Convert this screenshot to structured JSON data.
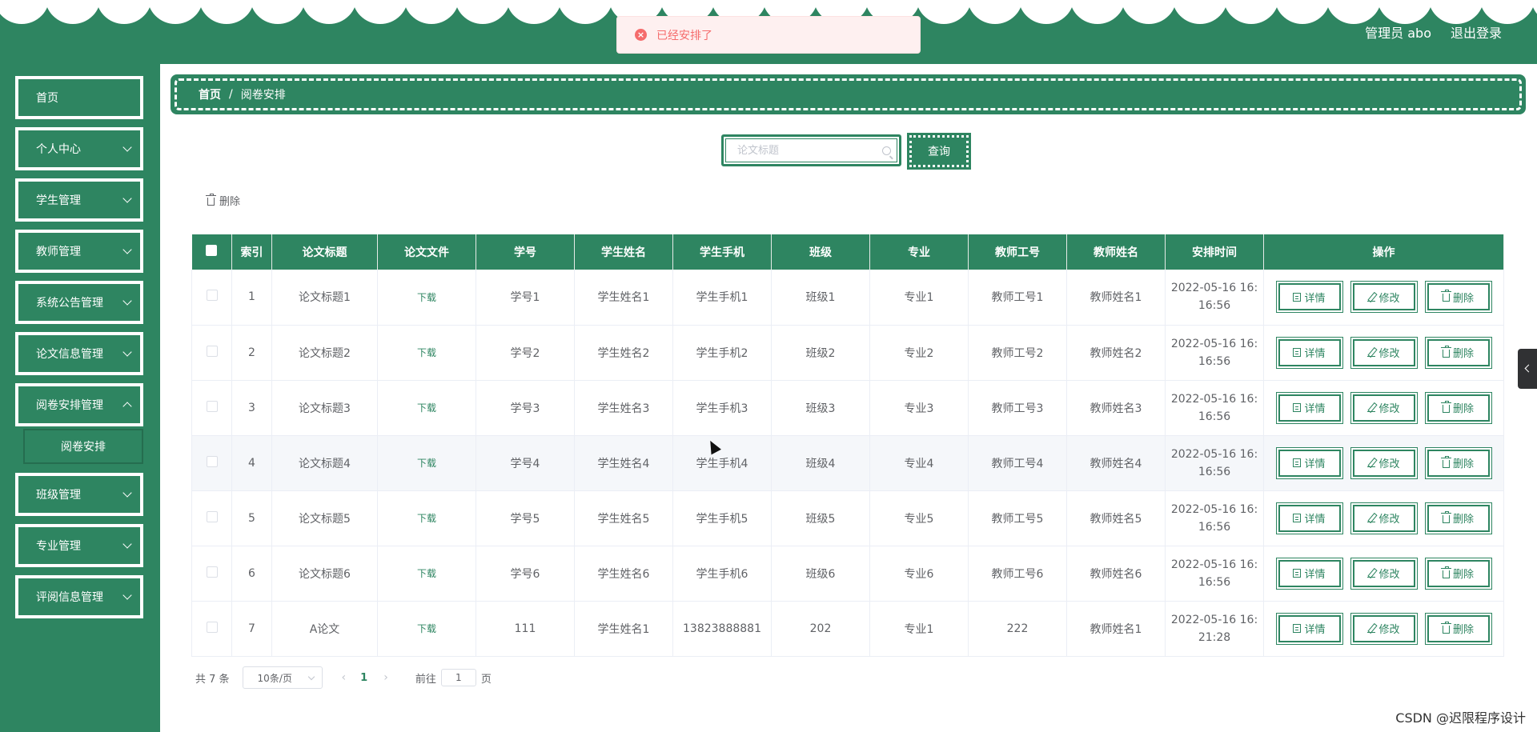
{
  "header": {
    "admin_label": "管理员 abo",
    "logout_label": "退出登录",
    "accent": "#2e8561"
  },
  "toast": {
    "message": "已经安排了",
    "type": "error"
  },
  "sidebar": {
    "items": [
      {
        "label": "首页",
        "has_children": false
      },
      {
        "label": "个人中心",
        "has_children": true
      },
      {
        "label": "学生管理",
        "has_children": true
      },
      {
        "label": "教师管理",
        "has_children": true
      },
      {
        "label": "系统公告管理",
        "has_children": true
      },
      {
        "label": "论文信息管理",
        "has_children": true
      },
      {
        "label": "阅卷安排管理",
        "has_children": true
      },
      {
        "label": "班级管理",
        "has_children": true
      },
      {
        "label": "专业管理",
        "has_children": true
      },
      {
        "label": "评阅信息管理",
        "has_children": true
      }
    ],
    "submenu": {
      "label": "阅卷安排"
    }
  },
  "breadcrumb": {
    "home": "首页",
    "separator": "/",
    "current": "阅卷安排"
  },
  "search": {
    "placeholder": "论文标题",
    "button_label": "查询"
  },
  "toolbar": {
    "batch_delete_label": "删除"
  },
  "table": {
    "columns": [
      "索引",
      "论文标题",
      "论文文件",
      "学号",
      "学生姓名",
      "学生手机",
      "班级",
      "专业",
      "教师工号",
      "教师姓名",
      "安排时间",
      "操作"
    ],
    "download_label": "下载",
    "actions": {
      "detail": "详情",
      "edit": "修改",
      "delete": "删除"
    },
    "rows": [
      {
        "index": "1",
        "title": "论文标题1",
        "student_no": "学号1",
        "student_name": "学生姓名1",
        "phone": "学生手机1",
        "class": "班级1",
        "major": "专业1",
        "teacher_no": "教师工号1",
        "teacher_name": "教师姓名1",
        "time_line1": "2022-05-16 16:",
        "time_line2": "16:56"
      },
      {
        "index": "2",
        "title": "论文标题2",
        "student_no": "学号2",
        "student_name": "学生姓名2",
        "phone": "学生手机2",
        "class": "班级2",
        "major": "专业2",
        "teacher_no": "教师工号2",
        "teacher_name": "教师姓名2",
        "time_line1": "2022-05-16 16:",
        "time_line2": "16:56"
      },
      {
        "index": "3",
        "title": "论文标题3",
        "student_no": "学号3",
        "student_name": "学生姓名3",
        "phone": "学生手机3",
        "class": "班级3",
        "major": "专业3",
        "teacher_no": "教师工号3",
        "teacher_name": "教师姓名3",
        "time_line1": "2022-05-16 16:",
        "time_line2": "16:56"
      },
      {
        "index": "4",
        "title": "论文标题4",
        "student_no": "学号4",
        "student_name": "学生姓名4",
        "phone": "学生手机4",
        "class": "班级4",
        "major": "专业4",
        "teacher_no": "教师工号4",
        "teacher_name": "教师姓名4",
        "time_line1": "2022-05-16 16:",
        "time_line2": "16:56"
      },
      {
        "index": "5",
        "title": "论文标题5",
        "student_no": "学号5",
        "student_name": "学生姓名5",
        "phone": "学生手机5",
        "class": "班级5",
        "major": "专业5",
        "teacher_no": "教师工号5",
        "teacher_name": "教师姓名5",
        "time_line1": "2022-05-16 16:",
        "time_line2": "16:56"
      },
      {
        "index": "6",
        "title": "论文标题6",
        "student_no": "学号6",
        "student_name": "学生姓名6",
        "phone": "学生手机6",
        "class": "班级6",
        "major": "专业6",
        "teacher_no": "教师工号6",
        "teacher_name": "教师姓名6",
        "time_line1": "2022-05-16 16:",
        "time_line2": "16:56"
      },
      {
        "index": "7",
        "title": "A论文",
        "student_no": "111",
        "student_name": "学生姓名1",
        "phone": "13823888881",
        "class": "202",
        "major": "专业1",
        "teacher_no": "222",
        "teacher_name": "教师姓名1",
        "time_line1": "2022-05-16 16:",
        "time_line2": "21:28"
      }
    ]
  },
  "pagination": {
    "total": "共 7 条",
    "page_size": "10条/页",
    "current_page": "1",
    "goto_label": "前往",
    "goto_value": "1",
    "page_suffix": "页"
  },
  "watermark": "CSDN @迟限程序设计"
}
